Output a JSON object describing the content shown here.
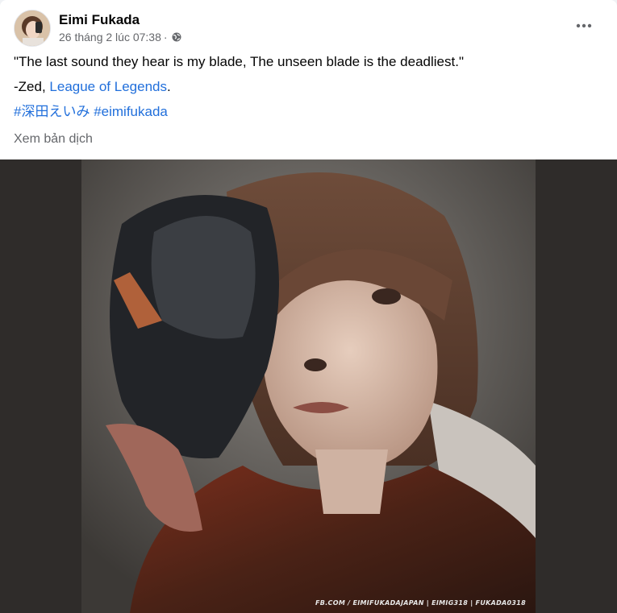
{
  "post": {
    "author": "Eimi Fukada",
    "timestamp": "26 tháng 2 lúc 07:38",
    "separator": "·",
    "privacy_icon": "globe-icon",
    "more_icon": "more-horizontal-icon",
    "quote": "\"The last sound they hear is my blade, The unseen blade is the deadliest.\"",
    "attribution_prefix": "-Zed, ",
    "attribution_link": "League of Legends",
    "attribution_suffix": ".",
    "hashtag_1": "#深田えいみ",
    "hashtag_2": "#eimifukada",
    "see_translation": "Xem bản dịch"
  },
  "photo": {
    "watermark": "FB.COM / EIMIFUKADAJAPAN   |   EIMIG318   |   FUKADA0318"
  },
  "colors": {
    "link": "#216fdb",
    "secondary_text": "#65676b",
    "media_background": "#2f2c2a"
  }
}
